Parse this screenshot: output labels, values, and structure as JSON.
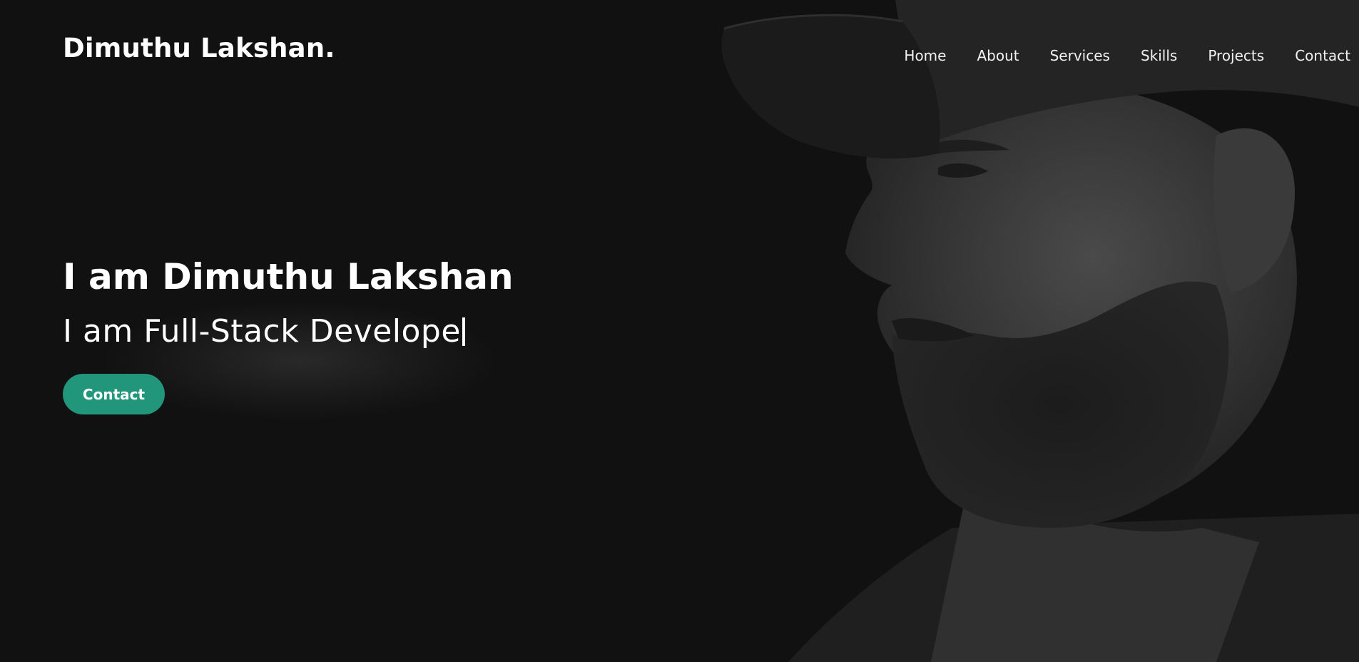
{
  "header": {
    "logo": "Dimuthu Lakshan.",
    "nav": [
      "Home",
      "About",
      "Services",
      "Skills",
      "Projects",
      "Contact"
    ]
  },
  "hero": {
    "title": "I am Dimuthu Lakshan",
    "typed_prefix": "I am ",
    "typed_text": "Full-Stack Develope",
    "cta_label": "Contact"
  },
  "colors": {
    "background": "#111111",
    "accent": "#22967b",
    "text": "#ffffff"
  },
  "icons": {
    "portrait": "person-portrait"
  }
}
